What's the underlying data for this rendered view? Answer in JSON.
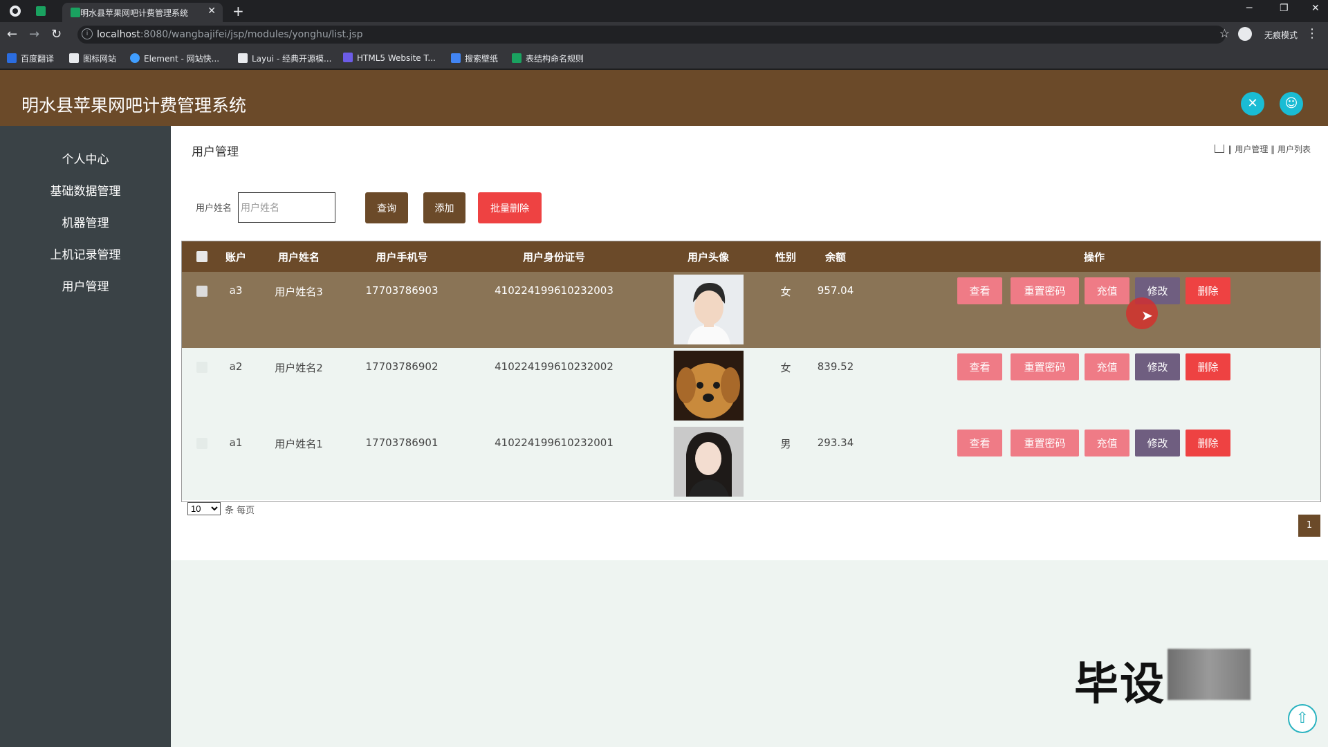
{
  "browser": {
    "tab_title": "明水县苹果网吧计费管理系统",
    "url_host": "localhost",
    "url_rest": ":8080/wangbajifei/jsp/modules/yonghu/list.jsp",
    "incognito_label": "无痕模式",
    "bookmarks": [
      {
        "label": "百度翻译",
        "color": "#2b6de0"
      },
      {
        "label": "图标网站",
        "color": "#e8eaed"
      },
      {
        "label": "Element - 网站快...",
        "color": "#409eff"
      },
      {
        "label": "Layui - 经典开源模...",
        "color": "#e8eaed"
      },
      {
        "label": "HTML5 Website T...",
        "color": "#6c5ce7"
      },
      {
        "label": "搜索壁纸",
        "color": "#4285f4"
      },
      {
        "label": "表结构命名规则",
        "color": "#1aa260"
      }
    ]
  },
  "app": {
    "title": "明水县苹果网吧计费管理系统",
    "header_color": "#6b4a29",
    "accent_cyan": "#1abcd4"
  },
  "sidebar": {
    "items": [
      {
        "label": "个人中心"
      },
      {
        "label": "基础数据管理"
      },
      {
        "label": "机器管理"
      },
      {
        "label": "上机记录管理"
      },
      {
        "label": "用户管理"
      }
    ]
  },
  "main": {
    "page_title": "用户管理",
    "breadcrumb": [
      "用户管理",
      "用户列表"
    ],
    "search": {
      "label": "用户姓名",
      "placeholder": "用户姓名",
      "value": ""
    },
    "buttons": {
      "query": "查询",
      "add": "添加",
      "batch_delete": "批量删除"
    },
    "table": {
      "headers": [
        "账户",
        "用户姓名",
        "用户手机号",
        "用户身份证号",
        "用户头像",
        "性别",
        "余额",
        "操作"
      ],
      "rows": [
        {
          "account": "a3",
          "name": "用户姓名3",
          "phone": "17703786903",
          "id_card": "410224199610232003",
          "avatar": "male-portrait",
          "gender": "女",
          "balance": "957.04",
          "selected": true
        },
        {
          "account": "a2",
          "name": "用户姓名2",
          "phone": "17703786902",
          "id_card": "410224199610232002",
          "avatar": "puppy-photo",
          "gender": "女",
          "balance": "839.52",
          "selected": false
        },
        {
          "account": "a1",
          "name": "用户姓名1",
          "phone": "17703786901",
          "id_card": "410224199610232001",
          "avatar": "female-portrait",
          "gender": "男",
          "balance": "293.34",
          "selected": false
        }
      ],
      "actions": {
        "view": "查看",
        "reset_password": "重置密码",
        "recharge": "充值",
        "edit": "修改",
        "delete": "删除"
      }
    },
    "pagination": {
      "page_size": "10",
      "page_size_label": "条 每页",
      "current_page": "1"
    }
  },
  "overlay": {
    "watermark": "毕设"
  }
}
